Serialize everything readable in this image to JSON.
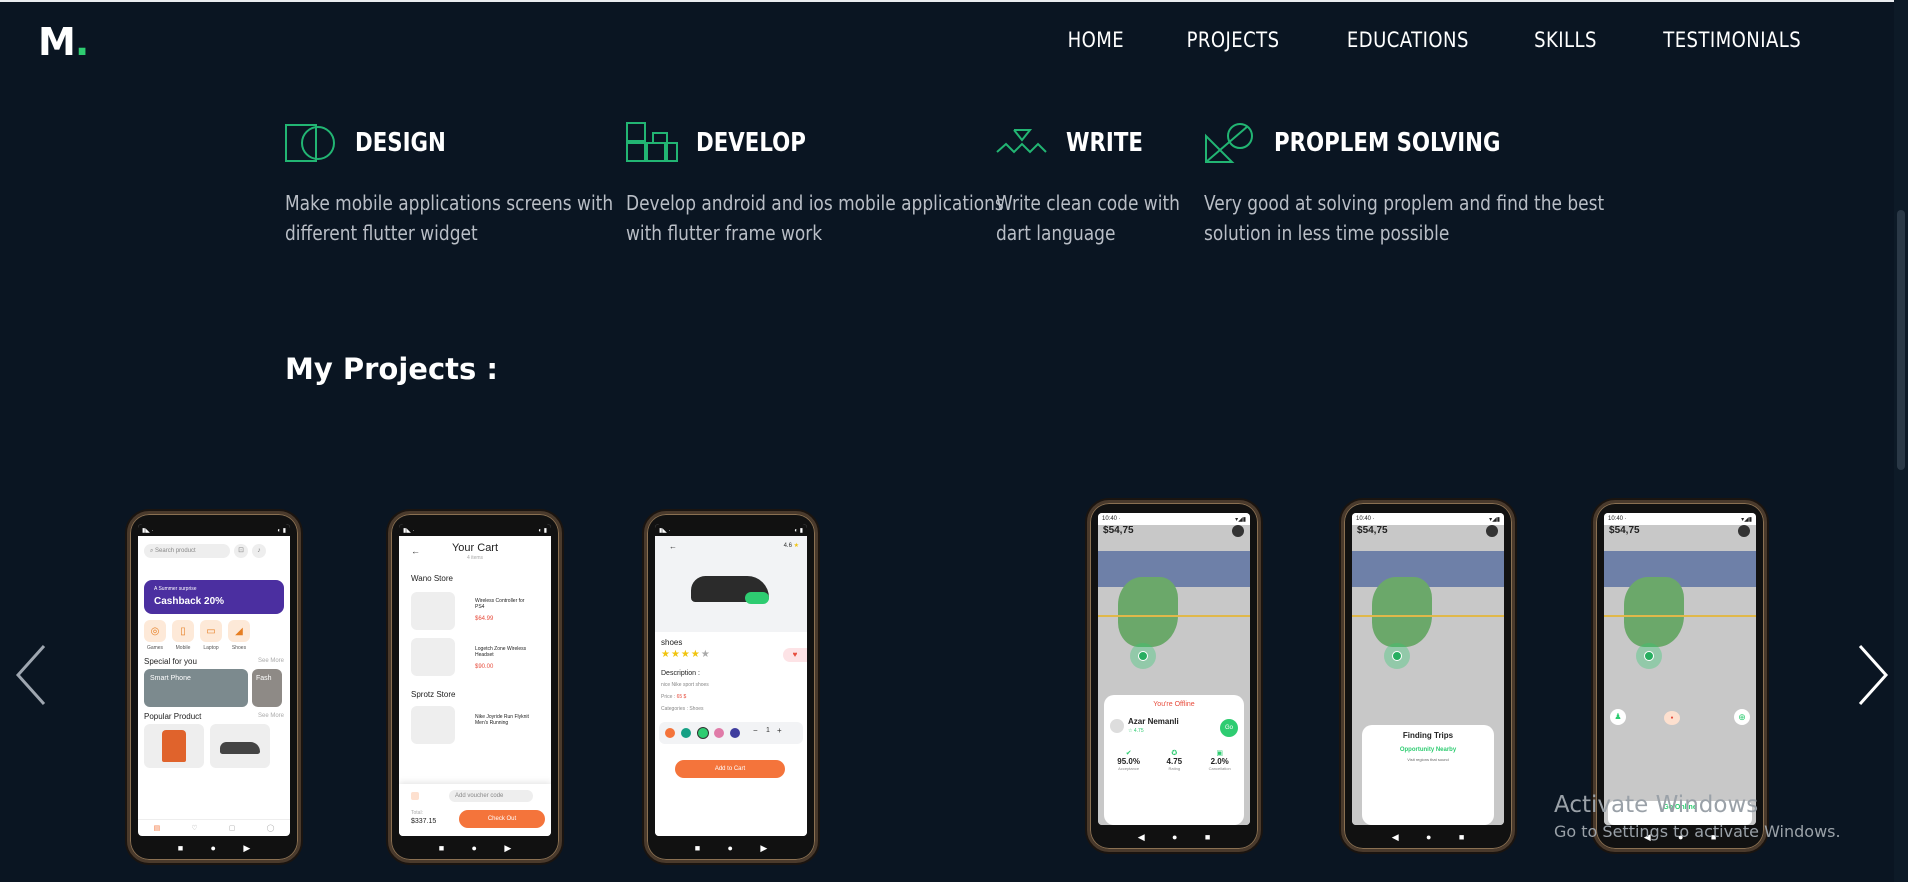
{
  "brand": {
    "logo_letter": "M",
    "logo_dot": ".",
    "accent": "#2ecc71"
  },
  "nav": {
    "items": [
      {
        "label": "HOME"
      },
      {
        "label": "PROJECTS"
      },
      {
        "label": "EDUCATIONS"
      },
      {
        "label": "SKILLS"
      },
      {
        "label": "TESTIMONIALS"
      }
    ]
  },
  "services": [
    {
      "icon": "design-shapes-icon",
      "title": "DESIGN",
      "desc_line1": "Make mobile applications screens with",
      "desc_line2": "different flutter widget"
    },
    {
      "icon": "develop-blocks-icon",
      "title": "DEVELOP",
      "desc_line1": "Develop android and ios mobile applications",
      "desc_line2": "with flutter frame work"
    },
    {
      "icon": "write-wave-icon",
      "title": "WRITE",
      "desc_line1": "Write clean code with",
      "desc_line2": "dart language"
    },
    {
      "icon": "problem-solving-icon",
      "title": "PROPLEM SOLVING",
      "desc_line1": "Very good at solving proplem and find the best",
      "desc_line2": "solution in less time possible"
    }
  ],
  "projects": {
    "title": "My Projects :",
    "ecommerce_home": {
      "search_placeholder": "Search product",
      "banner_small": "A Summer surprise",
      "banner_big": "Cashback 20%",
      "categories": [
        "Games",
        "Mobile",
        "Laptop",
        "Shoes"
      ],
      "special": "Special for you",
      "special_more": "See More",
      "tile1": "Smart Phone",
      "tile2": "Fash",
      "popular": "Popular Product",
      "popular_more": "See More"
    },
    "cart": {
      "title": "Your Cart",
      "subtitle": "4 items",
      "store1": "Wano Store",
      "item1": "Wireless Controller for PS4",
      "item1_price": "$64.99",
      "item2": "Logetch Zone Wireless Headset",
      "item2_price": "$90.00",
      "store2": "Sprotz Store",
      "item3": "Nike Joyride Run Flyknit Men's Running",
      "voucher": "Add voucher code",
      "total_label": "Total:",
      "total": "$337.15",
      "checkout": "Check Out"
    },
    "product": {
      "rating": "4.6",
      "name": "shoes",
      "desc_label": "Description :",
      "desc": "nice Nike sport shoes",
      "price_label": "Price :",
      "price": "65 $",
      "categories": "Categories : Shoes",
      "qty": "1",
      "add_to_cart": "Add to Cart"
    },
    "driver1": {
      "amount": "54,75",
      "offline": "You're Offline",
      "driver": "Azar Nemanli",
      "driver_rating": "4.75",
      "go": "Go",
      "stat1": "95.0%",
      "stat1_label": "Acceptance",
      "stat2": "4.75",
      "stat2_label": "Rating",
      "stat3": "2.0%",
      "stat3_label": "Cancellation"
    },
    "driver2": {
      "amount": "54,75",
      "finding": "Finding Trips",
      "opportunity": "Opportunity Nearby",
      "sub": "Visit regions that sound"
    },
    "driver3": {
      "amount": "54,75",
      "go_online": "Go Online"
    }
  },
  "watermark": {
    "line1": "Activate Windows",
    "line2": "Go to Settings to activate Windows."
  }
}
